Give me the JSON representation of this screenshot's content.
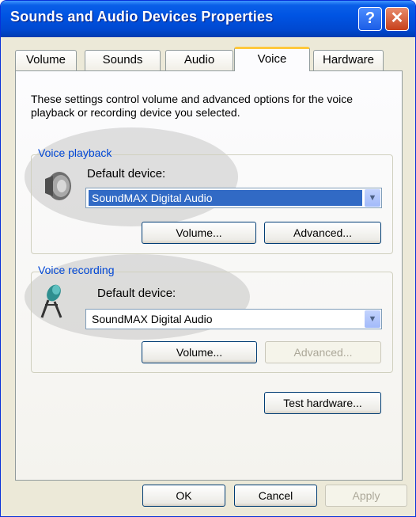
{
  "window": {
    "title": "Sounds and Audio Devices Properties"
  },
  "titlebar_buttons": {
    "help": "?",
    "close": "✕"
  },
  "tabs": [
    {
      "label": "Volume"
    },
    {
      "label": "Sounds"
    },
    {
      "label": "Audio"
    },
    {
      "label": "Voice"
    },
    {
      "label": "Hardware"
    }
  ],
  "active_tab": "Voice",
  "description": "These settings control volume and advanced options for the voice playback or recording device you selected.",
  "voice_playback": {
    "title": "Voice playback",
    "icon": "speaker-icon",
    "default_device_label": "Default device:",
    "default_device_value": "SoundMAX Digital Audio",
    "volume_button": "Volume...",
    "advanced_button": "Advanced..."
  },
  "voice_recording": {
    "title": "Voice recording",
    "icon": "microphone-icon",
    "default_device_label": "Default device:",
    "default_device_value": "SoundMAX Digital Audio",
    "volume_button": "Volume...",
    "advanced_button": "Advanced..."
  },
  "test_hardware_button": "Test hardware...",
  "footer": {
    "ok": "OK",
    "cancel": "Cancel",
    "apply": "Apply"
  },
  "colors": {
    "titlebar": "#0054e3",
    "tab_highlight": "#ffc83c",
    "selection": "#316ac5",
    "group_title": "#0046d5"
  }
}
